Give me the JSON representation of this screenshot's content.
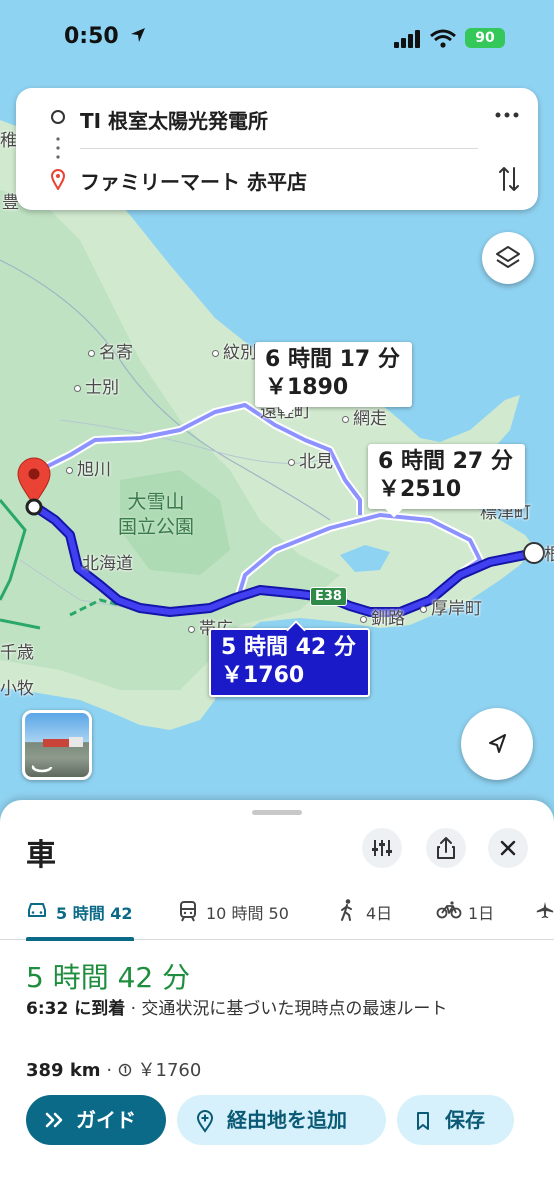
{
  "status_bar": {
    "time": "0:50",
    "battery": "90"
  },
  "directions": {
    "origin": "TI 根室太陽光発電所",
    "destination": "ファミリーマート 赤平店"
  },
  "map": {
    "places": {
      "nayoro": "名寄",
      "shibetsu": "士別",
      "monbetsu": "紋別",
      "asahikawa": "旭川",
      "kitami": "北見",
      "abashiri": "網走",
      "kushiro": "釧路",
      "akkeshi": "厚岸町",
      "hokkaido": "北海道",
      "chitose": "千歳",
      "tomakomai": "小牧",
      "toyo": "豊",
      "obihiro": "帯広",
      "left_fragment": "稚",
      "engaru": "遠軽町",
      "shibetsu_nemuro": "標津町",
      "nemuro_fragment": "根"
    },
    "park_name_line1": "大雪山",
    "park_name_line2": "国立公園",
    "highway_shield": "E38",
    "routes": [
      {
        "time": "5 時間 42 分",
        "toll": "￥1760",
        "selected": true
      },
      {
        "time": "6 時間 17 分",
        "toll": "￥1890",
        "selected": false
      },
      {
        "time": "6 時間 27 分",
        "toll": "￥2510",
        "selected": false
      }
    ]
  },
  "sheet": {
    "title": "車",
    "modes": [
      {
        "label": "5 時間 42",
        "icon": "car-icon"
      },
      {
        "label": "10 時間 50",
        "icon": "train-icon"
      },
      {
        "label": "4日",
        "icon": "walk-icon"
      },
      {
        "label": "1日",
        "icon": "bike-icon"
      }
    ],
    "duration": "5 時間 42 分",
    "arrival_time": "6:32 に到着",
    "arrival_note": " · 交通状況に基づいた現時点の最速ルート",
    "distance": "389 km",
    "toll": "￥1760",
    "buttons": {
      "guide": "ガイド",
      "add_stop": "経由地を追加",
      "save": "保存"
    }
  },
  "colors": {
    "accent": "#0b6a87",
    "route_primary": "#1a1ac8",
    "route_alt": "#8c92ff",
    "duration_green": "#1e8e3e",
    "land": "#cfe9d3",
    "sea": "#8ed3f2"
  }
}
